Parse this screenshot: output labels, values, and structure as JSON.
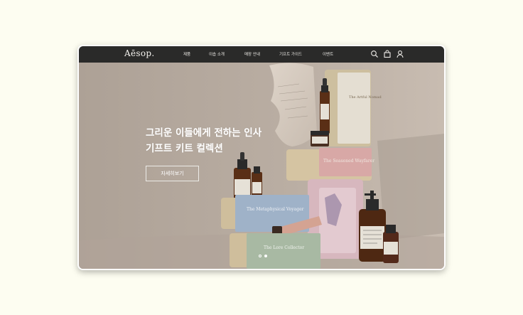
{
  "brand": {
    "logo": "Aēsop."
  },
  "nav": {
    "items": [
      {
        "label": "제품"
      },
      {
        "label": "이솝 소개"
      },
      {
        "label": "매장 안내"
      },
      {
        "label": "기프트 가이드"
      },
      {
        "label": "이벤트"
      }
    ],
    "icons": [
      "search-icon",
      "shopping-bag-icon",
      "user-icon"
    ]
  },
  "hero": {
    "headline_line1": "그리운 이들에게 전하는 인사",
    "headline_line2": "기프트 키트 컬렉션",
    "cta_label": "자세히보기",
    "carousel": {
      "total": 2,
      "active_index": 2
    },
    "product_labels": {
      "box_top": "The Artful Nomad",
      "box_pink": "The Seasoned Wayfarer",
      "box_blue": "The Metaphysical Voyager",
      "box_green": "The Lore Collector"
    }
  },
  "colors": {
    "page_background": "#fdfdf1",
    "nav_background": "#2a2a29",
    "hero_background": "#b3a89d"
  }
}
